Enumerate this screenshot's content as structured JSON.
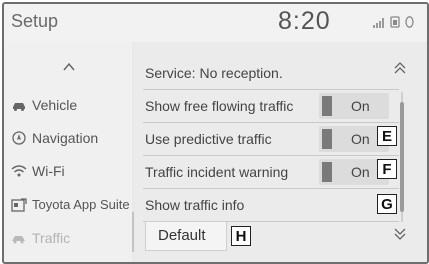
{
  "header": {
    "title": "Setup",
    "clock": "8:20"
  },
  "sidebar": {
    "items": [
      {
        "label": "Vehicle",
        "icon": "car-icon"
      },
      {
        "label": "Navigation",
        "icon": "compass-icon"
      },
      {
        "label": "Wi-Fi",
        "icon": "wifi-icon"
      },
      {
        "label": "Toyota App Suite",
        "icon": "app-suite-icon"
      },
      {
        "label": "Traffic",
        "icon": "traffic-icon"
      }
    ]
  },
  "main": {
    "status_text": "Service: No reception.",
    "rows": [
      {
        "label": "Show free flowing traffic",
        "toggle": "On"
      },
      {
        "label": "Use predictive traffic",
        "toggle": "On",
        "marker": "E"
      },
      {
        "label": "Traffic incident warning",
        "toggle": "On",
        "marker": "F"
      },
      {
        "label": "Show traffic info",
        "marker": "G"
      }
    ],
    "default_label": "Default",
    "default_marker": "H"
  },
  "colors": {
    "background": "#e9e9e9",
    "toggle_bar": "#7a7a7a"
  }
}
